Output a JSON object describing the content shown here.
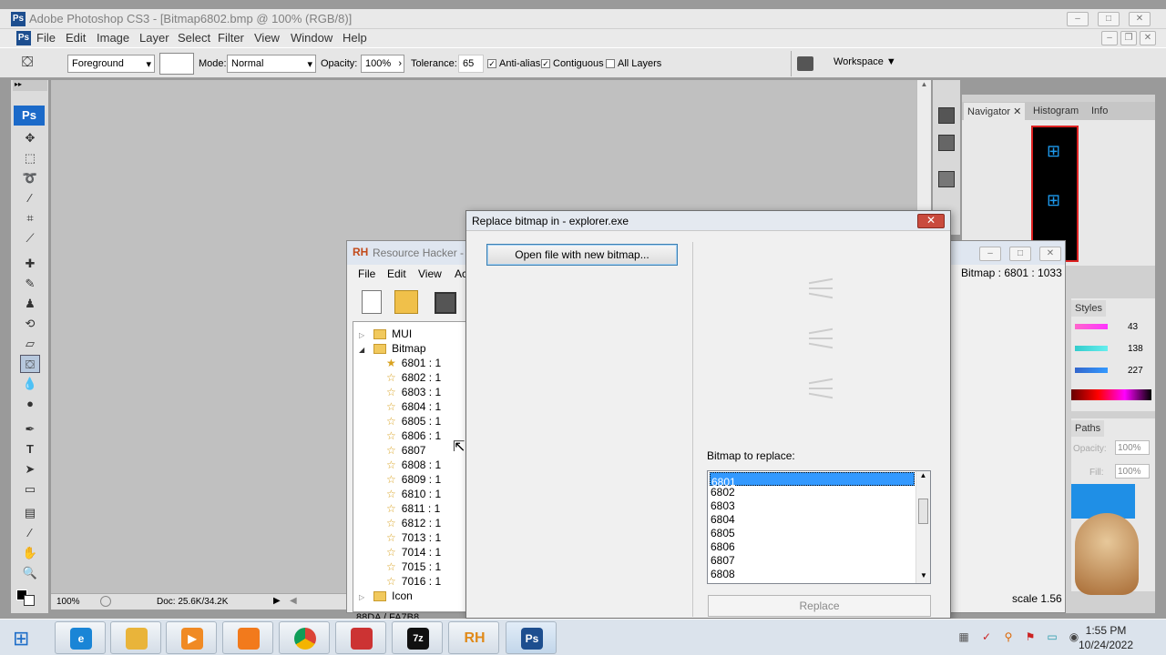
{
  "photoshop": {
    "title": "Adobe Photoshop CS3 - [Bitmap6802.bmp @ 100% (RGB/8)]",
    "menu": [
      "File",
      "Edit",
      "Image",
      "Layer",
      "Select",
      "Filter",
      "View",
      "Window",
      "Help"
    ],
    "options": {
      "fill_source": "Foreground",
      "mode_label": "Mode:",
      "mode_value": "Normal",
      "opacity_label": "Opacity:",
      "opacity_value": "100%",
      "tolerance_label": "Tolerance:",
      "tolerance_value": "65",
      "anti_alias": "Anti-alias",
      "contiguous": "Contiguous",
      "all_layers": "All Layers",
      "workspace": "Workspace"
    },
    "status": {
      "zoom": "100%",
      "doc": "Doc: 25.6K/34.2K"
    },
    "panels": {
      "tabs": [
        "Navigator",
        "Histogram",
        "Info"
      ],
      "color_values": [
        "43",
        "138",
        "227"
      ],
      "styles_tab": "Styles",
      "paths_tab": "Paths",
      "opacity_label": "Opacity:",
      "opacity_value": "100%",
      "fill_label": "Fill:",
      "fill_value": "100%"
    }
  },
  "resource_hacker": {
    "title": "Resource Hacker - e",
    "menu": [
      "File",
      "Edit",
      "View",
      "Ac"
    ],
    "bitmap_info": "Bitmap : 6801 : 1033",
    "scale": "scale 1.56",
    "tree": {
      "folder1": "MUI",
      "folder2": "Bitmap",
      "items": [
        "6801 : 1",
        "6802 : 1",
        "6803 : 1",
        "6804 : 1",
        "6805 : 1",
        "6806 : 1",
        "6807",
        "6808 : 1",
        "6809 : 1",
        "6810 : 1",
        "6811 : 1",
        "6812 : 1",
        "7013 : 1",
        "7014 : 1",
        "7015 : 1",
        "7016 : 1"
      ],
      "folder3": "Icon",
      "status": "88DA / FA7B8"
    }
  },
  "dialog": {
    "title": "Replace bitmap in - explorer.exe",
    "open_button": "Open file with new bitmap...",
    "list_label": "Bitmap to replace:",
    "list": [
      "6801",
      "6802",
      "6803",
      "6804",
      "6805",
      "6806",
      "6807",
      "6808"
    ],
    "replace_button": "Replace"
  },
  "taskbar": {
    "time": "1:55 PM",
    "date": "10/24/2022"
  }
}
